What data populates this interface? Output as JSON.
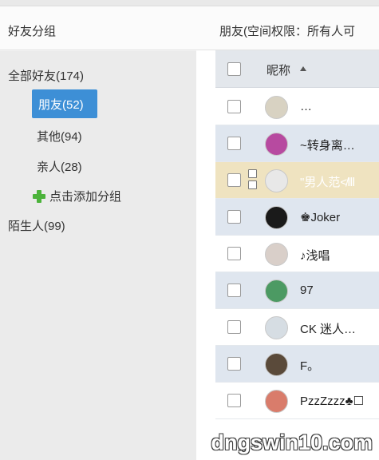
{
  "sidebar": {
    "title": "好友分组",
    "groups": {
      "all": "全部好友(174)",
      "friends": "朋友(52)",
      "other": "其他(94)",
      "family": "亲人(28)",
      "add": "点击添加分组",
      "strangers": "陌生人(99)"
    }
  },
  "main": {
    "title": "朋友(空间权限：所有人可",
    "column_header": "昵称",
    "rows": [
      {
        "nickname": "…",
        "avatar_color": "#d8d2c2"
      },
      {
        "nickname": "~转身离…",
        "avatar_color": "#b74aa0"
      },
      {
        "nickname": "\"男人范≮Ⅲ",
        "avatar_color": "#e8e8e8"
      },
      {
        "nickname": "♚Joker",
        "avatar_color": "#1a1a1a"
      },
      {
        "nickname": "♪浅唱",
        "avatar_color": "#d9cfc9"
      },
      {
        "nickname": "97",
        "avatar_color": "#4c9a63"
      },
      {
        "nickname": "CK 迷人…",
        "avatar_color": "#d6dde3"
      },
      {
        "nickname": "F。",
        "avatar_color": "#5a4a3a"
      },
      {
        "nickname": "PzzZzzz♣☐",
        "avatar_color": "#d97c6b"
      }
    ]
  },
  "watermark": "dngswin10.com",
  "colors": {
    "selected_group": "#3d8fd6",
    "row_alt": "#dfe6ef",
    "row_selected": "#efe3c0",
    "add_icon": "#4cb33b"
  }
}
